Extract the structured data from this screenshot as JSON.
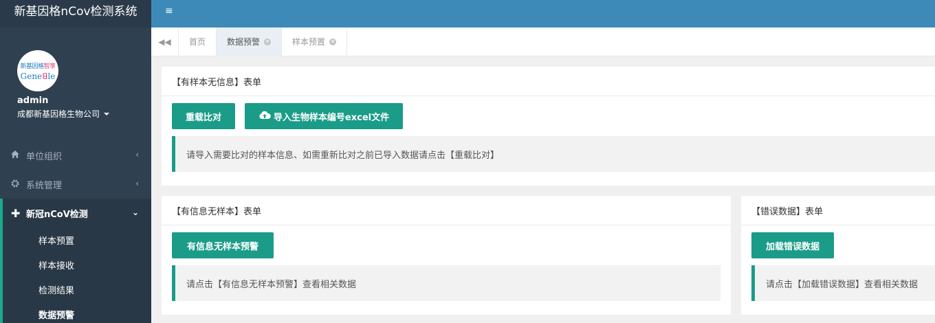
{
  "app": {
    "title": "新基因格nCov检测系统"
  },
  "profile": {
    "logo_top_a": "新基因格",
    "logo_top_b": "智享",
    "logo_mark": "Gene🧬le",
    "username": "admin",
    "company": "成都新基因格生物公司"
  },
  "sidebar": {
    "items": [
      {
        "label": "单位组织",
        "icon": "home-icon"
      },
      {
        "label": "系统管理",
        "icon": "gear-icon"
      },
      {
        "label": "新冠nCoV检测",
        "icon": "plus-icon"
      }
    ],
    "sub_items": [
      {
        "label": "样本预置"
      },
      {
        "label": "样本接收"
      },
      {
        "label": "检测结果"
      },
      {
        "label": "数据预警"
      }
    ]
  },
  "tabs": [
    {
      "label": "首页"
    },
    {
      "label": "数据预警"
    },
    {
      "label": "样本预置"
    }
  ],
  "panel1": {
    "title": "【有样本无信息】表单",
    "reload_label": "重载比对",
    "import_label": "导入生物样本编号excel文件",
    "note": "请导入需要比对的样本信息、如需重新比对之前已导入数据请点击【重载比对】"
  },
  "panel2": {
    "title": "【有信息无样本】表单",
    "button_label": "有信息无样本预警",
    "note": "请点击【有信息无样本预警】查看相关数据"
  },
  "panel3": {
    "title": "【错误数据】表单",
    "button_label": "加载错误数据",
    "note": "请点击【加载错误数据】查看相关数据"
  },
  "colors": {
    "accent": "#1a9c89",
    "sidebar": "#2f4050",
    "topbar": "#3d8ab8"
  }
}
